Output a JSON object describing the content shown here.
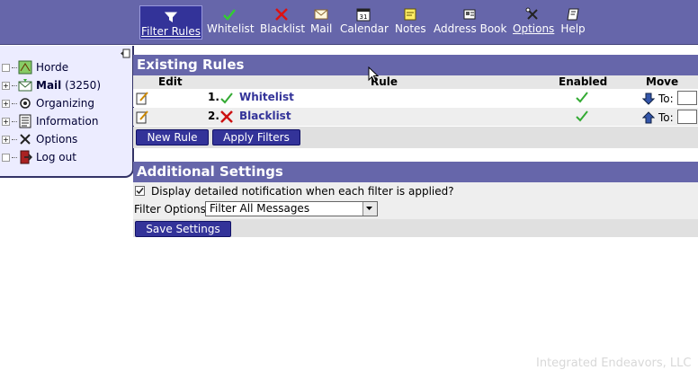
{
  "toolbar": {
    "items": [
      {
        "label": "Filter Rules",
        "icon": "funnel-icon",
        "active": true
      },
      {
        "label": "Whitelist",
        "icon": "checkmark-icon"
      },
      {
        "label": "Blacklist",
        "icon": "red-x-icon"
      },
      {
        "label": "Mail",
        "icon": "envelope-icon"
      },
      {
        "label": "Calendar",
        "icon": "calendar-icon",
        "icon_text": "31"
      },
      {
        "label": "Notes",
        "icon": "note-icon"
      },
      {
        "label": "Address Book",
        "icon": "address-book-icon"
      },
      {
        "label": "Options",
        "icon": "tools-icon"
      },
      {
        "label": "Help",
        "icon": "help-book-icon"
      }
    ]
  },
  "sidebar": {
    "items": [
      {
        "label": "Horde",
        "icon": "horde-map-icon",
        "toggle": ""
      },
      {
        "label": "Mail",
        "count": "(3250)",
        "icon": "mail-icon",
        "toggle": "+"
      },
      {
        "label": "Organizing",
        "icon": "organizing-icon",
        "toggle": "+"
      },
      {
        "label": "Information",
        "icon": "information-icon",
        "toggle": "+"
      },
      {
        "label": "Options",
        "icon": "options-icon",
        "toggle": "+"
      },
      {
        "label": "Log out",
        "icon": "logout-icon",
        "toggle": ""
      }
    ]
  },
  "existing_rules": {
    "title": "Existing Rules",
    "columns": {
      "edit": "Edit",
      "rule": "Rule",
      "enabled": "Enabled",
      "move": "Move"
    },
    "rows": [
      {
        "num": "1.",
        "name": "Whitelist",
        "icon": "checkmark-icon",
        "enabled": true,
        "move_icon": "arrow-down-icon",
        "to_label": "To:"
      },
      {
        "num": "2.",
        "name": "Blacklist",
        "icon": "red-x-icon",
        "enabled": true,
        "move_icon": "arrow-up-icon",
        "to_label": "To:"
      }
    ],
    "new_rule_label": "New Rule",
    "apply_filters_label": "Apply Filters"
  },
  "additional_settings": {
    "title": "Additional Settings",
    "notify_label": "Display detailed notification when each filter is applied?",
    "notify_checked": true,
    "filter_options_label": "Filter Options",
    "filter_options_value": "Filter All Messages",
    "save_label": "Save Settings"
  },
  "footer": {
    "text": "Integrated Endeavors, LLC"
  },
  "colors": {
    "header": "#6666aa",
    "button": "#333399",
    "sidebar": "#ececff"
  }
}
